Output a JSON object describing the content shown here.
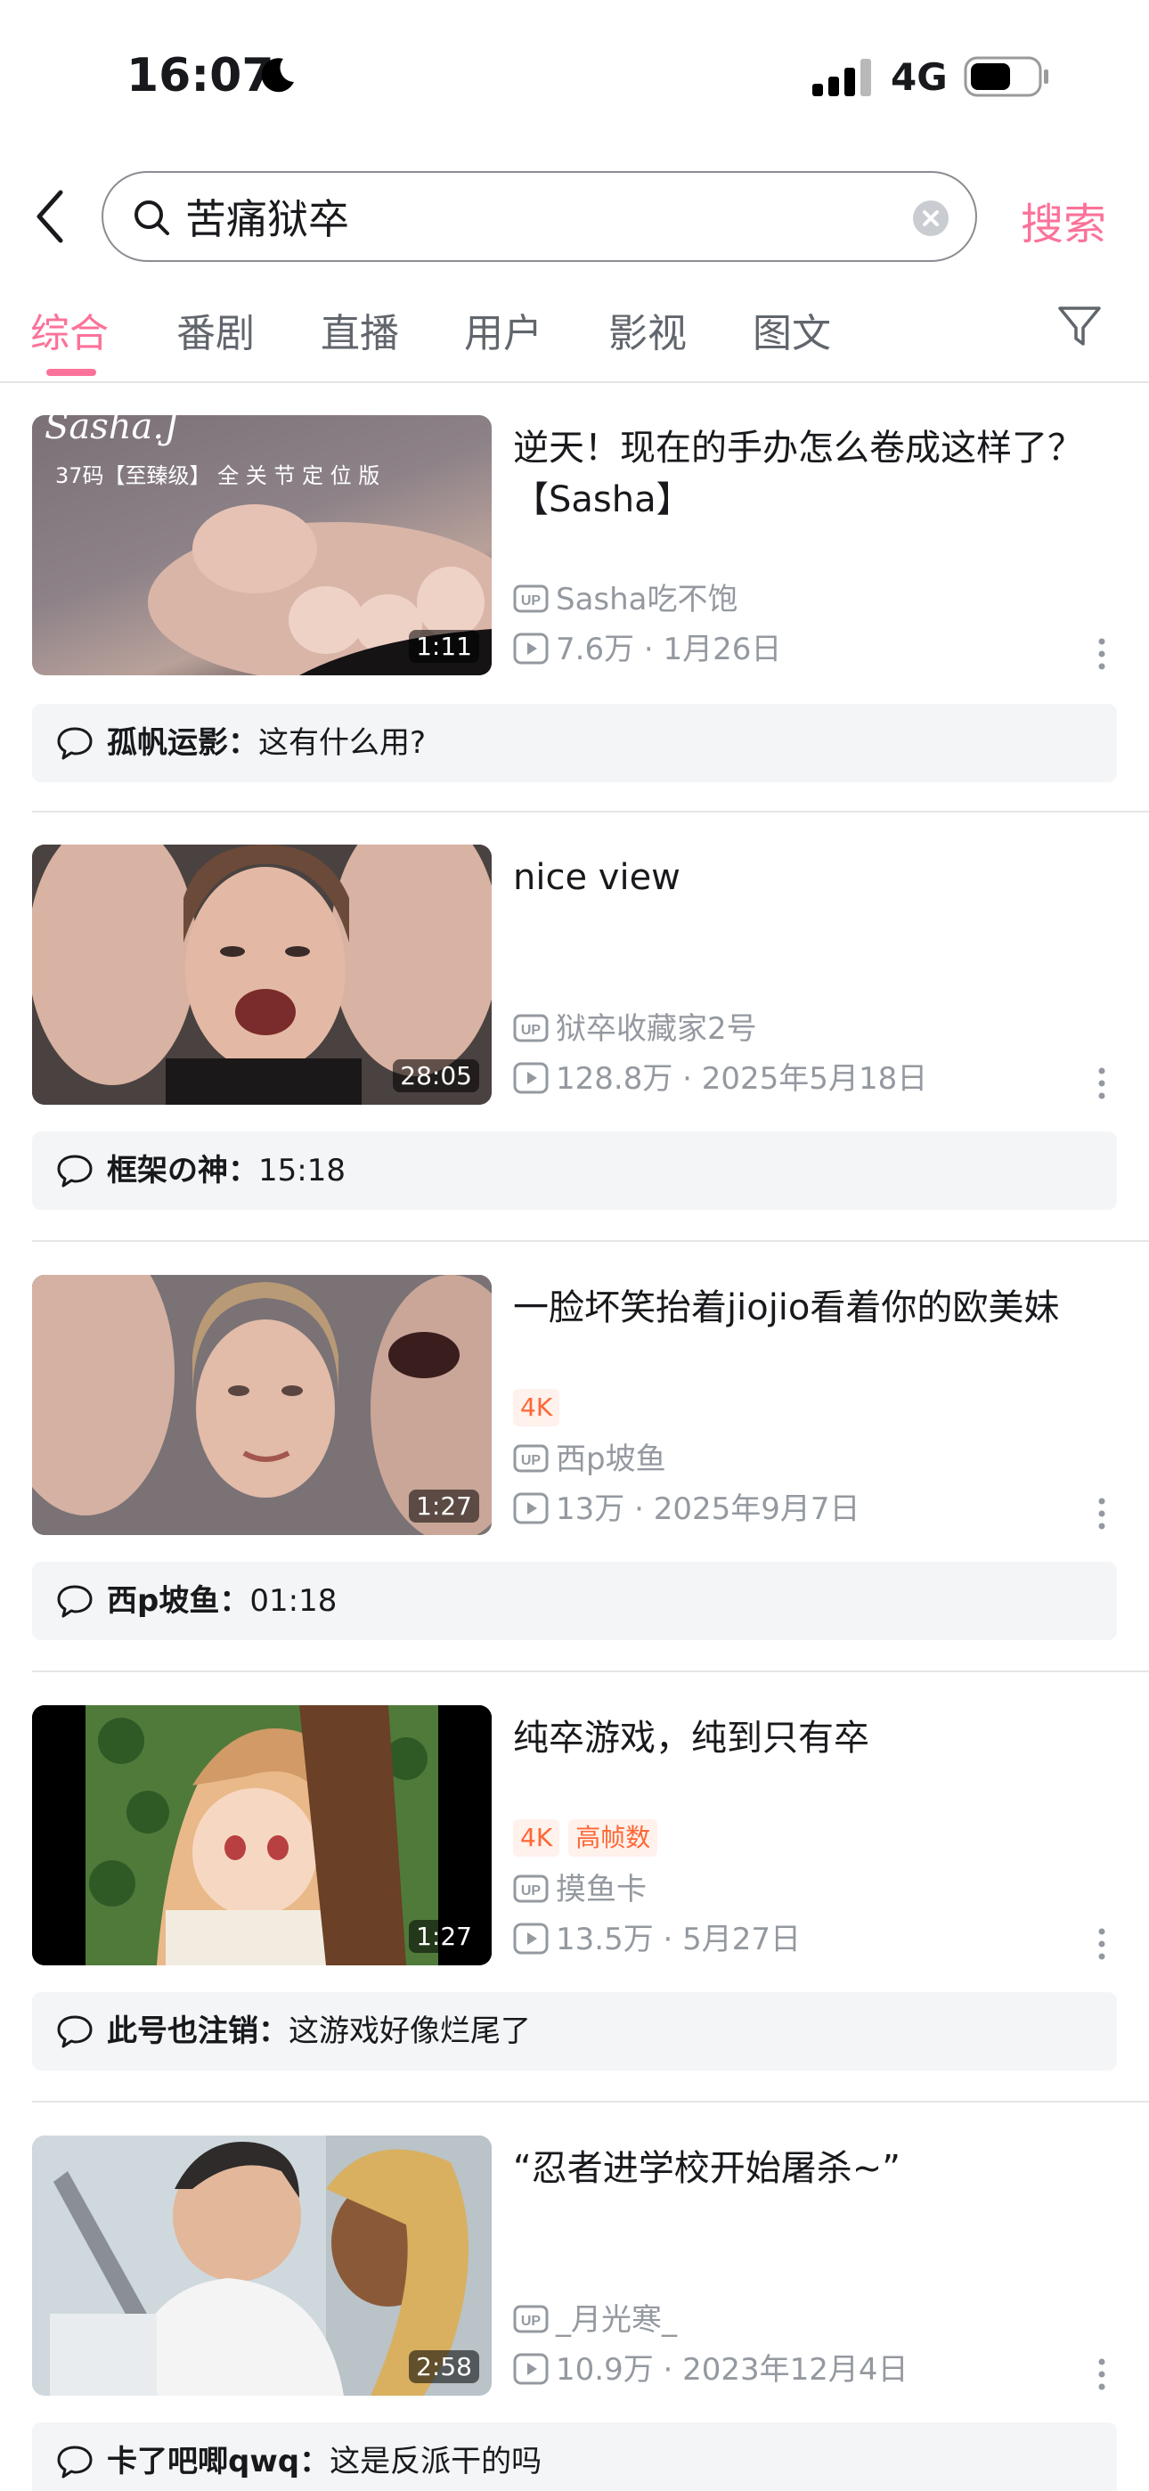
{
  "status_bar": {
    "time": "16:07",
    "network": "4G"
  },
  "search": {
    "query": "苦痛狱卒",
    "button_label": "搜索"
  },
  "tabs": [
    {
      "label": "综合",
      "active": true
    },
    {
      "label": "番剧"
    },
    {
      "label": "直播"
    },
    {
      "label": "用户"
    },
    {
      "label": "影视"
    },
    {
      "label": "图文"
    }
  ],
  "accent_color": "#fb7299",
  "results": [
    {
      "title": "逆天！现在的手办怎么卷成这样了？【Sasha】",
      "duration": "1:11",
      "tags": [],
      "uploader": "Sasha吃不饱",
      "views": "7.6万",
      "date": "1月26日",
      "comment_user": "孤帆运影：",
      "comment_text": "这有什么用?",
      "thumb_text_line1": "Sasha.J",
      "thumb_text_line2": "37码【至臻级】 全 关 节 定 位 版"
    },
    {
      "title": "nice view",
      "duration": "28:05",
      "tags": [],
      "uploader": "狱卒收藏家2号",
      "views": "128.8万",
      "date": "2025年5月18日",
      "comment_user": "框架の神：",
      "comment_text": "15:18"
    },
    {
      "title": "一脸坏笑抬着jiojio看着你的欧美妹",
      "duration": "1:27",
      "tags": [
        "4K"
      ],
      "uploader": "西p坡鱼",
      "views": "13万",
      "date": "2025年9月7日",
      "comment_user": "西p坡鱼：",
      "comment_text": "01:18"
    },
    {
      "title": "纯卒游戏，纯到只有卒",
      "duration": "1:27",
      "tags": [
        "4K",
        "高帧数"
      ],
      "uploader": "摸鱼卡",
      "views": "13.5万",
      "date": "5月27日",
      "comment_user": "此号也注销：",
      "comment_text": "这游戏好像烂尾了"
    },
    {
      "title": "“忍者进学校开始屠杀~”",
      "duration": "2:58",
      "tags": [],
      "uploader": "_月光寒_",
      "views": "10.9万",
      "date": "2023年12月4日",
      "comment_user": "卡了吧唧qwq：",
      "comment_text": "这是反派干的吗"
    }
  ]
}
